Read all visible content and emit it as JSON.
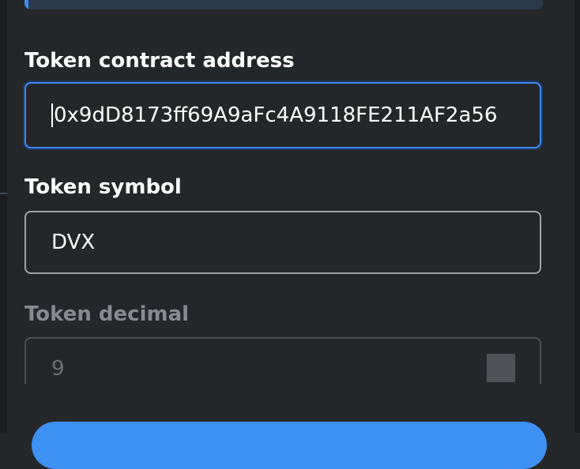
{
  "form": {
    "contract_address": {
      "label": "Token contract address",
      "value": "0x9dD8173ff69A9aFc4A9118FE211AF2a56"
    },
    "symbol": {
      "label": "Token symbol",
      "value": "DVX"
    },
    "decimal": {
      "label": "Token decimal",
      "value": "9"
    }
  },
  "colors": {
    "accent": "#3d8bf0",
    "background": "#24272a",
    "text": "#ffffff",
    "disabled_text": "#878b91"
  }
}
